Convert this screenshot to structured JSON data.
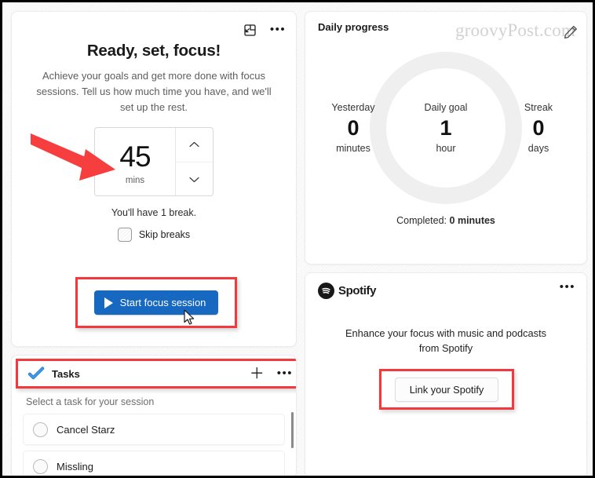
{
  "focus": {
    "popout_icon": "popout-miniview-icon",
    "more_icon": "more-options-icon",
    "title": "Ready, set, focus!",
    "subtitle": "Achieve your goals and get more done with focus sessions. Tell us how much time you have, and we'll set up the rest.",
    "timer": {
      "value": "45",
      "unit": "mins",
      "up_icon": "chevron-up-icon",
      "down_icon": "chevron-down-icon"
    },
    "break_note": "You'll have 1 break.",
    "skip_breaks_label": "Skip breaks",
    "skip_breaks_checked": false,
    "start_button_label": "Start focus session",
    "play_icon": "play-icon"
  },
  "tasks": {
    "logo_icon": "microsoft-todo-check-icon",
    "title": "Tasks",
    "add_icon": "plus-icon",
    "more_icon": "more-options-icon",
    "hint": "Select a task for your session",
    "items": [
      {
        "label": "Cancel Starz",
        "selected": false
      },
      {
        "label": "Missling",
        "selected": false
      }
    ]
  },
  "progress": {
    "title": "Daily progress",
    "watermark": "groovyPost.com",
    "edit_icon": "pencil-edit-icon",
    "stats": [
      {
        "caption": "Yesterday",
        "value": "0",
        "unit": "minutes"
      },
      {
        "caption": "Daily goal",
        "value": "1",
        "unit": "hour"
      },
      {
        "caption": "Streak",
        "value": "0",
        "unit": "days"
      }
    ],
    "completed_label": "Completed:",
    "completed_value": "0 minutes"
  },
  "spotify": {
    "logo_icon": "spotify-logo-icon",
    "brand": "Spotify",
    "more_icon": "more-options-icon",
    "description": "Enhance your focus with music and podcasts from Spotify",
    "link_button_label": "Link your Spotify"
  },
  "annotations": {
    "highlight_color": "#f4393c",
    "arrow_color": "#f73e3e",
    "accent_blue": "#1668c0"
  }
}
